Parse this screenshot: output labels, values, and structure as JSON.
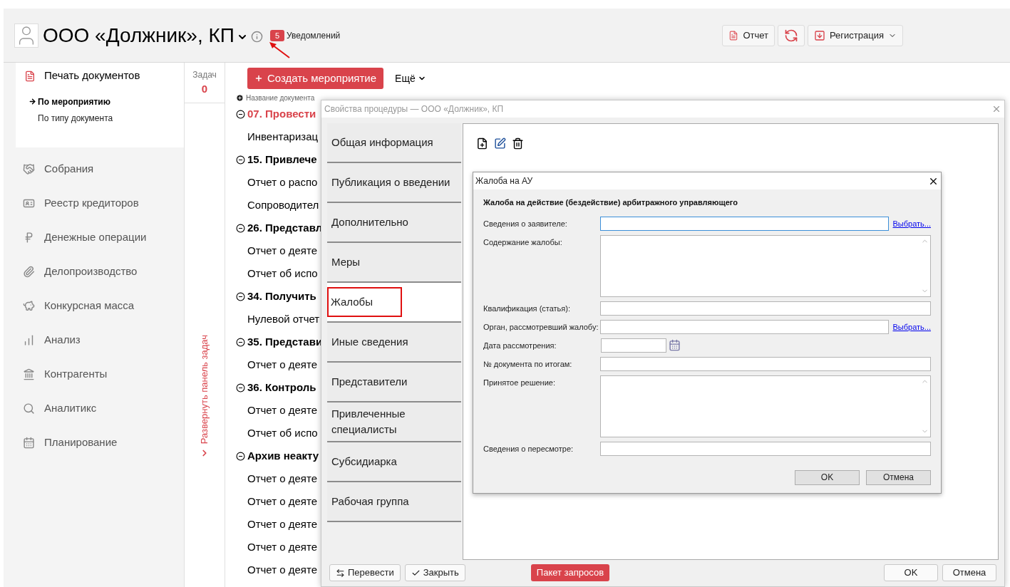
{
  "header": {
    "title": "ООО «Должник», КП",
    "notifications": {
      "count": "5",
      "label": "Уведомлений"
    },
    "buttons": [
      {
        "kind": "report",
        "label": "Отчет"
      },
      {
        "kind": "sync"
      },
      {
        "kind": "register",
        "label": "Регистрация"
      }
    ]
  },
  "sidebar": {
    "section": {
      "label": "Печать документов",
      "selected": true,
      "children": [
        {
          "label": "По мероприятию",
          "selected": true
        },
        {
          "label": "По типу документа",
          "selected": false
        }
      ]
    },
    "items": [
      {
        "label": "Собрания"
      },
      {
        "label": "Реестр кредиторов"
      },
      {
        "label": "Денежные операции"
      },
      {
        "label": "Делопроизводство"
      },
      {
        "label": "Конкурсная масса"
      },
      {
        "label": "Анализ"
      },
      {
        "label": "Контрагенты"
      },
      {
        "label": "Аналитикс"
      },
      {
        "label": "Планирование"
      }
    ]
  },
  "tasks": {
    "label": "Задач",
    "count": "0",
    "expand_label": "Развернуть панель задач"
  },
  "toolbar": {
    "create_button": "Создать мероприятие",
    "more_button": "Ещё"
  },
  "document_list": {
    "column_header": "Название документа",
    "rows": [
      {
        "kind": "group",
        "label": "07. Провести",
        "expanded": true,
        "current": true
      },
      {
        "kind": "doc",
        "label": "Инвентаризац",
        "current": false
      },
      {
        "kind": "group",
        "label": "15. Привлече",
        "expanded": true,
        "current": false
      },
      {
        "kind": "doc",
        "label": "Отчет о распо",
        "current": false
      },
      {
        "kind": "doc",
        "label": "Сопроводител",
        "current": false
      },
      {
        "kind": "group",
        "label": "26. Представл",
        "expanded": true,
        "current": false
      },
      {
        "kind": "doc",
        "label": "Отчет о деяте",
        "current": false
      },
      {
        "kind": "doc",
        "label": "Отчет об испо",
        "current": false
      },
      {
        "kind": "group",
        "label": "34. Получить",
        "expanded": true,
        "current": false
      },
      {
        "kind": "doc",
        "label": "Нулевой отчет",
        "current": false
      },
      {
        "kind": "group",
        "label": "35. Представи",
        "expanded": true,
        "current": false
      },
      {
        "kind": "doc",
        "label": "Отчет о деяте",
        "current": false
      },
      {
        "kind": "group",
        "label": "36. Контроль",
        "expanded": true,
        "current": false
      },
      {
        "kind": "doc",
        "label": "Отчет о деяте",
        "current": false
      },
      {
        "kind": "doc",
        "label": "Отчет об испо",
        "current": false
      },
      {
        "kind": "group",
        "label": "Архив неакту",
        "expanded": true,
        "current": false
      },
      {
        "kind": "doc",
        "label": "Отчет о деяте",
        "current": false
      },
      {
        "kind": "doc",
        "label": "Отчет о деяте",
        "current": false
      },
      {
        "kind": "doc",
        "label": "Отчет о деяте",
        "current": false
      },
      {
        "kind": "doc",
        "label": "Отчет о деяте",
        "current": false
      },
      {
        "kind": "doc",
        "label": "Отчет о деяте",
        "current": false
      }
    ]
  },
  "procedure_dialog": {
    "title": "Свойства процедуры — ООО «Должник», КП",
    "tabs": [
      {
        "label": "Общая информация",
        "selected": false,
        "highlighted": false
      },
      {
        "label": "Публикация о введении",
        "selected": false,
        "highlighted": false
      },
      {
        "label": "Дополнительно",
        "selected": false,
        "highlighted": false
      },
      {
        "label": "Меры",
        "selected": false,
        "highlighted": false
      },
      {
        "label": "Жалобы",
        "selected": true,
        "highlighted": true
      },
      {
        "label": "Иные сведения",
        "selected": false,
        "highlighted": false
      },
      {
        "label": "Представители",
        "selected": false,
        "highlighted": false
      },
      {
        "label": "Привлеченные специалисты",
        "selected": false,
        "highlighted": false
      },
      {
        "label": "Субсидиарка",
        "selected": false,
        "highlighted": false
      },
      {
        "label": "Рабочая группа",
        "selected": false,
        "highlighted": false
      }
    ],
    "footer": {
      "left_buttons": [
        {
          "kind": "transfer",
          "label": "Перевести"
        },
        {
          "kind": "close",
          "label": "Закрыть"
        }
      ],
      "requests_button": "Пакет запросов",
      "right_buttons": [
        "OK",
        "Отмена"
      ]
    }
  },
  "complaint_dialog": {
    "title": "Жалоба на АУ",
    "heading": "Жалоба на действие (бездействие) арбитражного управляющего",
    "fields": [
      {
        "kind": "text",
        "label": "Сведения о заявителе:",
        "link": "Выбрать...",
        "focused": true
      },
      {
        "kind": "textarea",
        "label": "Содержание жалобы:",
        "focused": false
      },
      {
        "kind": "text",
        "label": "Квалификация (статья):",
        "focused": false
      },
      {
        "kind": "text",
        "label": "Орган, рассмотревший жалобу:",
        "link": "Выбрать...",
        "focused": false
      },
      {
        "kind": "date",
        "label": "Дата рассмотрения:",
        "focused": false
      },
      {
        "kind": "text",
        "label": "№ документа по итогам:",
        "focused": false
      },
      {
        "kind": "textarea",
        "label": "Принятое решение:",
        "focused": false
      },
      {
        "kind": "text",
        "label": "Сведения о пересмотре:",
        "focused": false
      }
    ],
    "buttons": [
      "OK",
      "Отмена"
    ]
  }
}
